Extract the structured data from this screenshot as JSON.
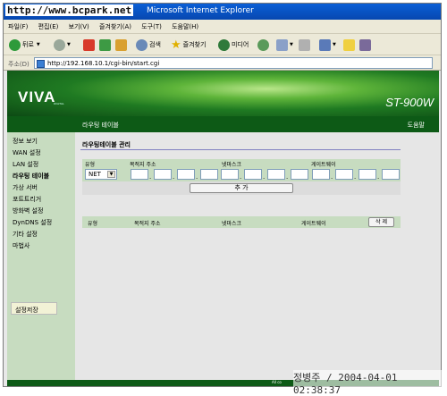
{
  "window": {
    "title": "Microsoft Internet Explorer",
    "watermark": "http://www.bcpark.net"
  },
  "menu": [
    "파일(F)",
    "편집(E)",
    "보기(V)",
    "즐겨찾기(A)",
    "도구(T)",
    "도움말(H)"
  ],
  "toolbar": {
    "back": "뒤로",
    "search": "검색",
    "favorites": "즐겨찾기",
    "media": "미디어"
  },
  "address": {
    "label": "주소(D)",
    "url": "http://192.168.10.1/cgi-bin/start.cgi"
  },
  "banner": {
    "logo": "VIVA",
    "logo_sub": "DIGITAL",
    "model": "ST-900W"
  },
  "header": {
    "page": "라우팅 테이블",
    "help": "도움말"
  },
  "sidebar": {
    "items": [
      "정보 보기",
      "WAN 설정",
      "LAN 설정",
      "라우팅 테이블",
      "가상 서버",
      "포트트리거",
      "방화벽 설정",
      "DynDNS 설정",
      "기타 설정",
      "마법사"
    ],
    "active_index": 3,
    "save_label": "설정저장"
  },
  "routing": {
    "section_title": "라우팅테이블 관리",
    "col_type": "유형",
    "col_dest": "목적지 주소",
    "col_mask": "넷마스크",
    "col_gw": "게이트웨이",
    "type_value": "NET",
    "add_label": "추 가"
  },
  "list": {
    "col_type": "유형",
    "col_dest": "목적지 주소",
    "col_mask": "넷마스크",
    "col_gw": "게이트웨이",
    "delete_label": "삭 제"
  },
  "footer": {
    "all_text": "All co",
    "watermark": "정병주 / 2004-04-01 02:38:37"
  },
  "colors": {
    "menu_green": "#0d5a16",
    "sidebar_bg": "#c7dcc0",
    "titlebar": "#0a5fd6"
  }
}
